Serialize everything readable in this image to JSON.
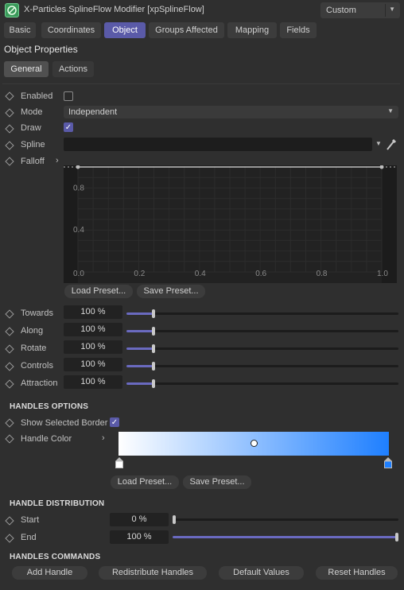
{
  "header": {
    "title": "X-Particles SplineFlow Modifier [xpSplineFlow]",
    "preset": "Custom",
    "icon": "xparticles-splineflow-icon"
  },
  "tabs": [
    {
      "label": "Basic"
    },
    {
      "label": "Coordinates"
    },
    {
      "label": "Object",
      "active": true
    },
    {
      "label": "Groups Affected"
    },
    {
      "label": "Mapping"
    },
    {
      "label": "Fields"
    }
  ],
  "section_title": "Object Properties",
  "subtabs": [
    {
      "label": "General",
      "active": true
    },
    {
      "label": "Actions"
    }
  ],
  "params": {
    "enabled": {
      "label": "Enabled",
      "checked": false
    },
    "mode": {
      "label": "Mode",
      "value": "Independent"
    },
    "draw": {
      "label": "Draw",
      "checked": true
    },
    "spline": {
      "label": "Spline",
      "value": ""
    },
    "falloff": {
      "label": "Falloff"
    }
  },
  "falloff_graph": {
    "y_ticks": [
      "0.8",
      "0.4"
    ],
    "x_ticks": [
      "0.0",
      "0.2",
      "0.4",
      "0.6",
      "0.8",
      "1.0"
    ],
    "curve": [
      [
        0.0,
        1.0
      ],
      [
        1.0,
        1.0
      ]
    ]
  },
  "falloff_buttons": {
    "load": "Load Preset...",
    "save": "Save Preset..."
  },
  "sliders": [
    {
      "label": "Towards",
      "value": "100 %",
      "fraction": 0.1
    },
    {
      "label": "Along",
      "value": "100 %",
      "fraction": 0.1
    },
    {
      "label": "Rotate",
      "value": "100 %",
      "fraction": 0.1
    },
    {
      "label": "Controls",
      "value": "100 %",
      "fraction": 0.1
    },
    {
      "label": "Attraction",
      "value": "100 %",
      "fraction": 0.1
    }
  ],
  "handles_options": {
    "title": "HANDLES OPTIONS",
    "show_selected_border": {
      "label": "Show Selected Border",
      "checked": true
    },
    "handle_color": {
      "label": "Handle Color",
      "gradient_start": "#ffffff",
      "gradient_end": "#1e7fff"
    },
    "load": "Load Preset...",
    "save": "Save Preset..."
  },
  "handle_distribution": {
    "title": "HANDLE DISTRIBUTION",
    "start": {
      "label": "Start",
      "value": "0 %",
      "fraction": 0.0
    },
    "end": {
      "label": "End",
      "value": "100 %",
      "fraction": 1.0
    }
  },
  "handles_commands": {
    "title": "HANDLES COMMANDS",
    "buttons": [
      "Add Handle",
      "Redistribute Handles",
      "Default Values",
      "Reset Handles"
    ]
  },
  "colors": {
    "accent": "#5a5aa8",
    "background": "#2f2f2f"
  }
}
